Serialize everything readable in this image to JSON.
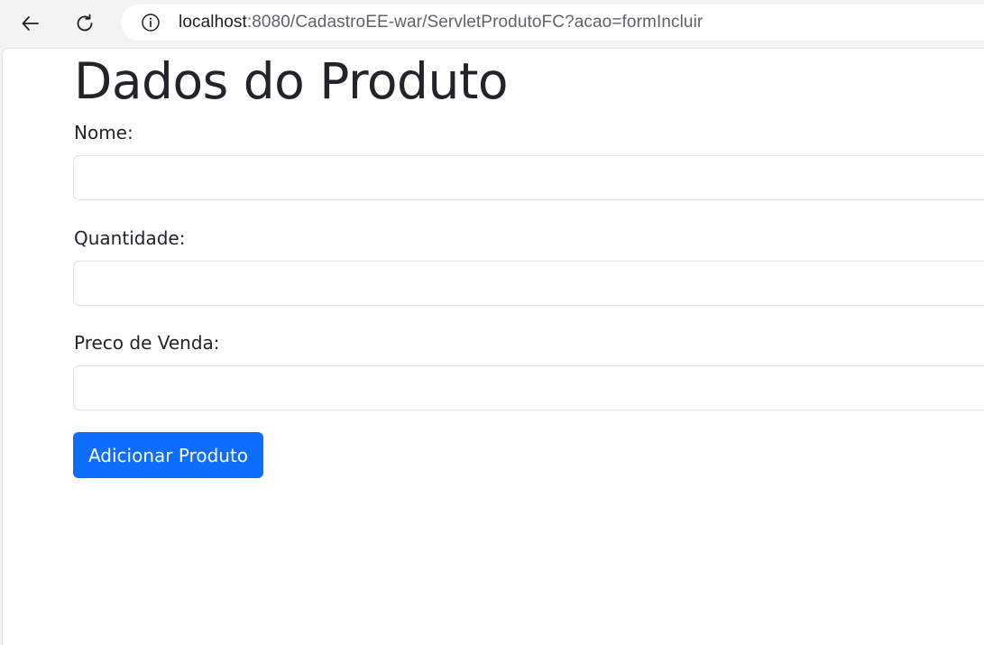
{
  "browser": {
    "url_host": "localhost",
    "url_rest": ":8080/CadastroEE-war/ServletProdutoFC?acao=formIncluir",
    "icons": {
      "back": "arrow-left-icon",
      "reload": "reload-icon",
      "site_info": "info-icon"
    }
  },
  "page": {
    "title": "Dados do Produto",
    "form": {
      "fields": [
        {
          "label": "Nome:",
          "value": "",
          "placeholder": ""
        },
        {
          "label": "Quantidade:",
          "value": "",
          "placeholder": ""
        },
        {
          "label": "Preco de Venda:",
          "value": "",
          "placeholder": ""
        }
      ],
      "submit_label": "Adicionar Produto"
    }
  },
  "colors": {
    "primary": "#0d6efd",
    "text": "#212529",
    "input_border": "#dee2e6"
  }
}
